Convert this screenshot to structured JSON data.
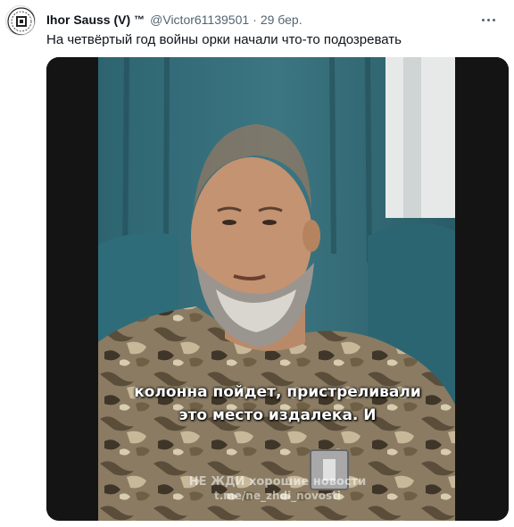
{
  "tweet": {
    "author_name": "Ihor Sauss (V)",
    "badge": "™",
    "handle": "@Victor61139501",
    "separator": "·",
    "date": "29 бер.",
    "text": "На четвёртый год войны орки начали что-то подозревать"
  },
  "video": {
    "subtitle_line1": "колонна пойдет, пристреливали",
    "subtitle_line2": "это место издалека. И",
    "watermark_line1": "НЕ ЖДИ хорошие новости",
    "watermark_line2": "t.me/ne_zhdi_novosti"
  },
  "icons": {
    "more": "more-horizontal-icon",
    "avatar": "avatar-logo"
  }
}
